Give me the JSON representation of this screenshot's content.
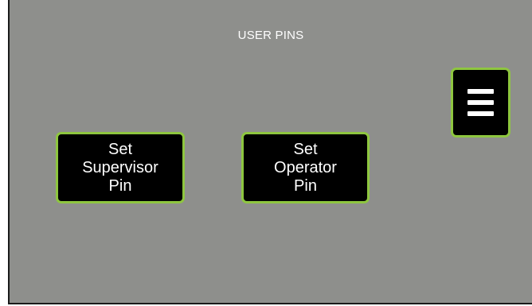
{
  "screen": {
    "title": "USER PINS",
    "accent_color": "#8ec63f",
    "background_color": "#8e8f8c"
  },
  "buttons": {
    "supervisor": {
      "line1": "Set",
      "line2": "Supervisor",
      "line3": "Pin"
    },
    "operator": {
      "line1": "Set",
      "line2": "Operator",
      "line3": "Pin"
    }
  },
  "menu": {
    "icon": "hamburger-menu-icon"
  }
}
